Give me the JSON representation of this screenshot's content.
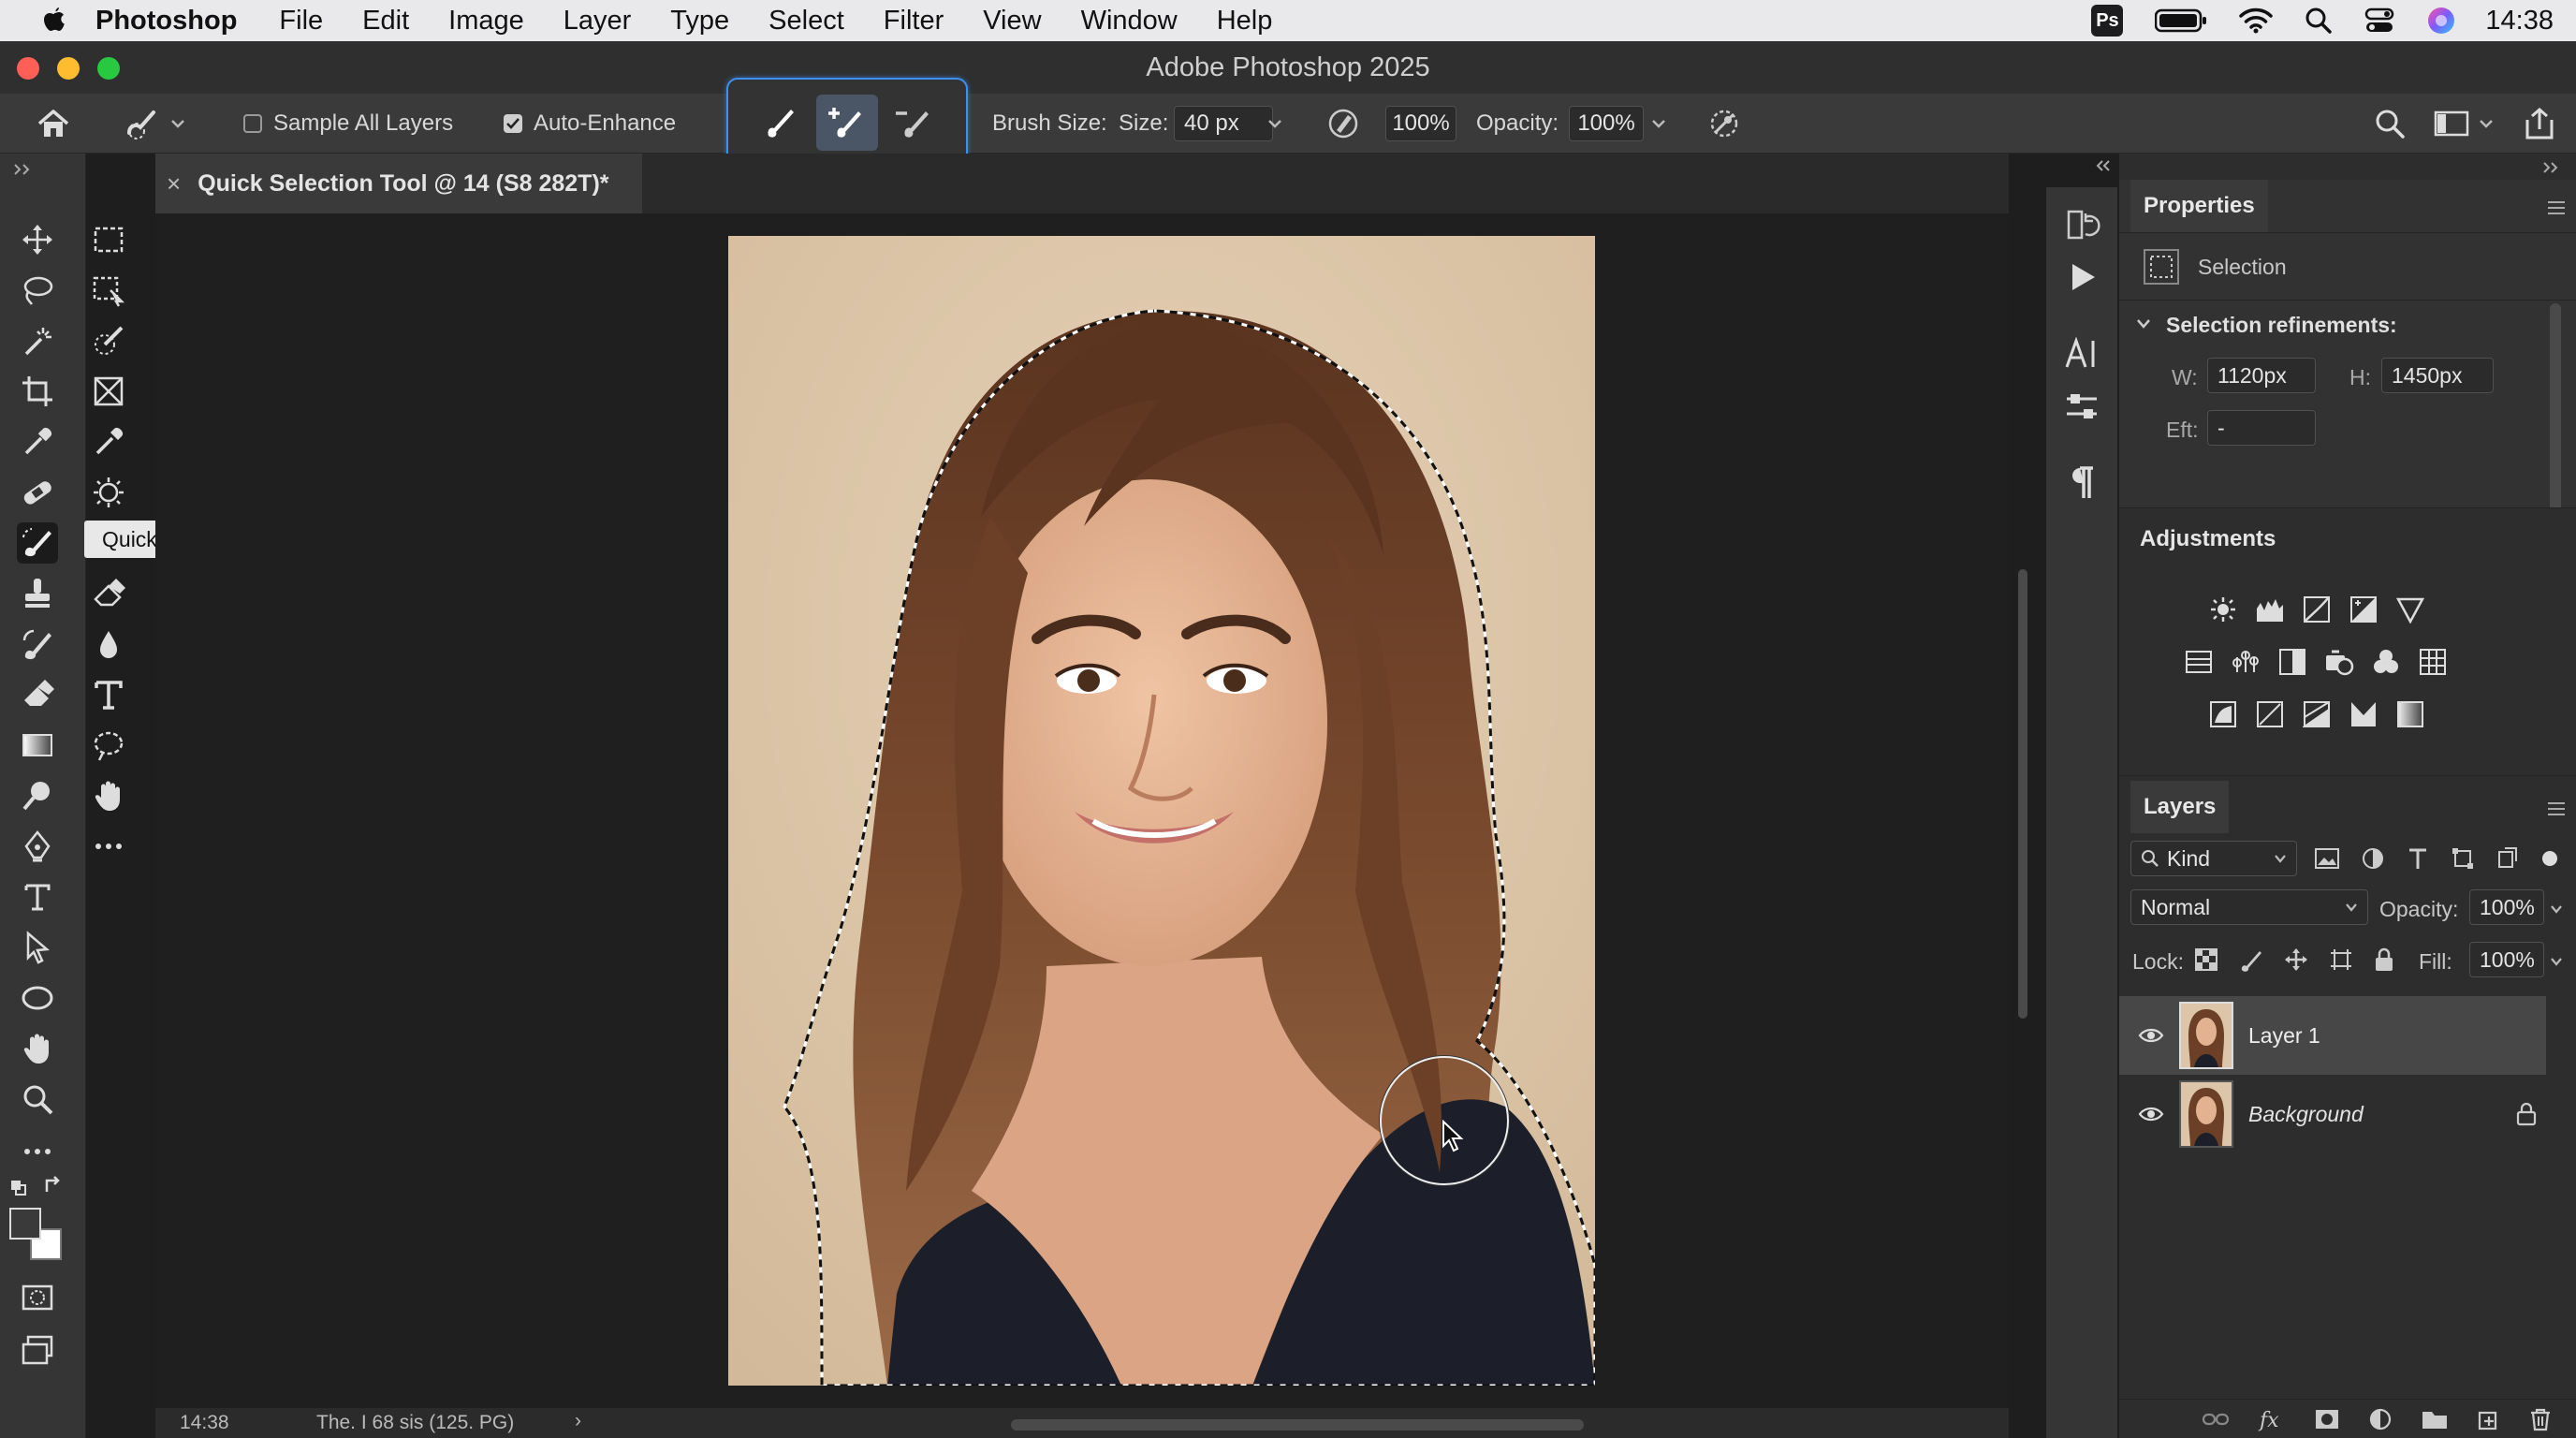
{
  "menubar": {
    "app_name": "Photoshop",
    "items": [
      "File",
      "Edit",
      "Image",
      "Layer",
      "Type",
      "Select",
      "Filter",
      "View",
      "Window",
      "Help"
    ],
    "ps_badge": "Ps",
    "clock": "14:38"
  },
  "window": {
    "title": "Adobe Photoshop 2025"
  },
  "options": {
    "sample_all_layers_label": "Sample All Layers",
    "sample_all_layers_checked": false,
    "auto_enhance_label": "Auto-Enhance",
    "auto_enhance_checked": true,
    "brush_size_label": "Brush Size:",
    "size_label": "Size:",
    "size_value": "40 px",
    "hardness_value": "100%",
    "opacity_label": "Opacity:",
    "opacity_value": "100%"
  },
  "document": {
    "tab_title": "Quick Selection Tool @ 14 (S8 282T)*",
    "close_glyph": "×"
  },
  "tooltip": {
    "text": "Quick Selection Tool"
  },
  "status": {
    "time": "14:38",
    "info": "The. I 68 sis (125. PG)",
    "arrow": "›"
  },
  "properties": {
    "tab": "Properties",
    "type": "Selection",
    "refinements_label": "Selection refinements:",
    "w_label": "W:",
    "w_value": "1120px",
    "h_label": "H:",
    "h_value": "1450px",
    "eft_label": "Eft:",
    "eft_value": "-"
  },
  "adjustments": {
    "tab": "Adjustments"
  },
  "layers": {
    "tab": "Layers",
    "filter": "Kind",
    "blend_mode": "Normal",
    "opacity_label": "Opacity:",
    "opacity_value": "100%",
    "lock_label": "Lock:",
    "fill_label": "Fill:",
    "fill_value": "100%",
    "items": [
      {
        "name": "Layer 1",
        "selected": true,
        "visible": true,
        "locked": false
      },
      {
        "name": "Background",
        "selected": false,
        "visible": true,
        "locked": true
      }
    ]
  },
  "colors": {
    "accent": "#3d8ff0",
    "panel_bg": "#323232",
    "canvas_bg": "#1f1f1f",
    "photo_bg": "#dcc5a9",
    "hair": "#6b4027",
    "skin": "#e2b291",
    "shirt": "#1c1f2a"
  }
}
